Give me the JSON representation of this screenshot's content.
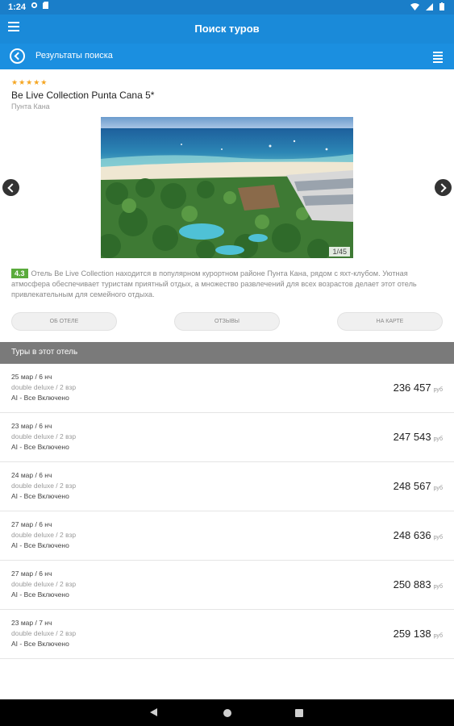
{
  "status_bar": {
    "time": "1:24"
  },
  "app_bar": {
    "title": "Поиск туров"
  },
  "sub_bar": {
    "title": "Результаты поиска"
  },
  "hotel": {
    "stars": "★★★★★",
    "star_count": 5,
    "name": "Be Live Collection Punta Cana 5*",
    "location": "Пунта Кана"
  },
  "gallery": {
    "counter": "1/45"
  },
  "description": {
    "rating": "4.3",
    "text": "Отель Be Live Collection находится в популярном курортном районе Пунта Кана, рядом с яхт-клубом. Уютная атмосфера обеспечивает туристам приятный отдых, а множество развлечений для всех возрастов делает этот отель привлекательным для семейного отдыха."
  },
  "actions": {
    "about": "ОБ ОТЕЛЕ",
    "reviews": "ОТЗЫВЫ",
    "map": "НА КАРТЕ"
  },
  "tours": {
    "header": "Туры в этот отель",
    "items": [
      {
        "date": "25 мар / 6 нч",
        "room": "double deluxe / 2 взр",
        "meal": "AI - Все Включено",
        "price": "236 457",
        "currency": "руб"
      },
      {
        "date": "23 мар / 6 нч",
        "room": "double deluxe / 2 взр",
        "meal": "AI - Все Включено",
        "price": "247 543",
        "currency": "руб"
      },
      {
        "date": "24 мар / 6 нч",
        "room": "double deluxe / 2 взр",
        "meal": "AI - Все Включено",
        "price": "248 567",
        "currency": "руб"
      },
      {
        "date": "27 мар / 6 нч",
        "room": "double deluxe / 2 взр",
        "meal": "AI - Все Включено",
        "price": "248 636",
        "currency": "руб"
      },
      {
        "date": "27 мар / 6 нч",
        "room": "double deluxe / 2 взр",
        "meal": "AI - Все Включено",
        "price": "250 883",
        "currency": "руб"
      },
      {
        "date": "23 мар / 7 нч",
        "room": "double deluxe / 2 взр",
        "meal": "AI - Все Включено",
        "price": "259 138",
        "currency": "руб"
      }
    ]
  },
  "colors": {
    "status_bar": "#1a7ec9",
    "app_bar": "#1a8ad9",
    "sub_bar": "#1b8fe0",
    "stars": "#f5a623",
    "rating_badge": "#5aab3c",
    "tours_header": "#7a7a7a"
  },
  "icons": {
    "menu": "hamburger-menu-icon",
    "back": "circle-back-arrow-icon",
    "list": "list-view-icon",
    "gallery_prev": "chevron-left-icon",
    "gallery_next": "chevron-right-icon"
  }
}
